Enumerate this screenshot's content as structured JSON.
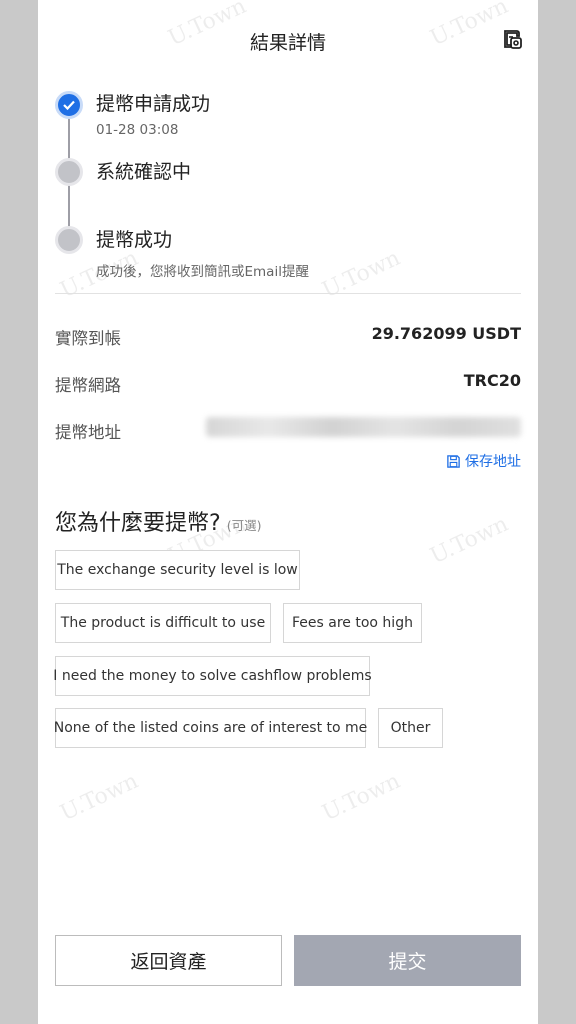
{
  "header": {
    "title": "結果詳情",
    "receipt_icon": "receipt-icon"
  },
  "timeline": [
    {
      "title": "提幣申請成功",
      "subtitle": "01-28 03:08",
      "state": "done"
    },
    {
      "title": "系統確認中",
      "subtitle": "",
      "state": "pending"
    },
    {
      "title": "提幣成功",
      "subtitle": "成功後，您將收到簡訊或Email提醒",
      "state": "pending"
    }
  ],
  "details": {
    "amount_label": "實際到帳",
    "amount_value": "29.762099 USDT",
    "network_label": "提幣網路",
    "network_value": "TRC20",
    "address_label": "提幣地址",
    "save_address": "保存地址"
  },
  "survey": {
    "question": "您為什麼要提幣?",
    "optional": "(可選)",
    "reasons": [
      "The exchange security level is low",
      "The product is difficult to use",
      "Fees are too high",
      "I need the money to solve cashflow problems",
      "None of the listed coins are of interest to me",
      "Other"
    ]
  },
  "actions": {
    "back_label": "返回資產",
    "submit_label": "提交"
  },
  "watermark": "U.Town",
  "colors": {
    "accent": "#1f6fe5",
    "submit_disabled": "#a3a7b2",
    "pending_dot": "#c2c3c8"
  }
}
